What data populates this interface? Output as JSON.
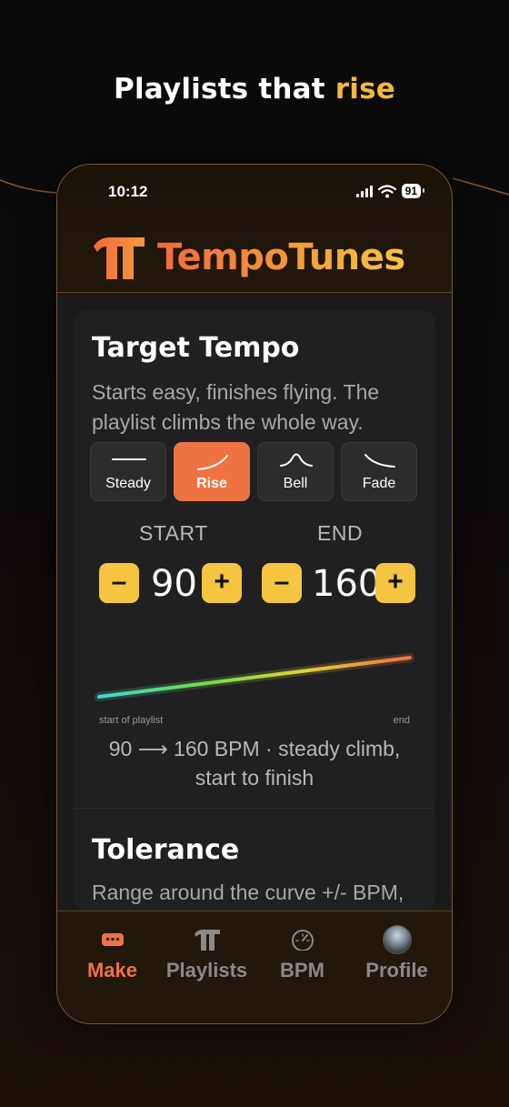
{
  "headline": {
    "prefix": "Playlists that",
    "accent": "rise"
  },
  "status_bar": {
    "time": "10:12",
    "battery": "91"
  },
  "app": {
    "name": "TempoTunes"
  },
  "target_tempo": {
    "title": "Target Tempo",
    "description": "Starts easy, finishes flying. The playlist climbs the whole way.",
    "modes": [
      {
        "label": "Steady",
        "icon": "flat-line-icon",
        "active": false
      },
      {
        "label": "Rise",
        "icon": "rising-curve-icon",
        "active": true
      },
      {
        "label": "Bell",
        "icon": "bell-curve-icon",
        "active": false
      },
      {
        "label": "Fade",
        "icon": "falling-curve-icon",
        "active": false
      }
    ],
    "start": {
      "label": "START",
      "value": "90",
      "minus": "–",
      "plus": "+"
    },
    "end": {
      "label": "END",
      "value": "160",
      "minus": "–",
      "plus": "+"
    },
    "axis_start": "start of playlist",
    "axis_end": "end",
    "summary": "90 ⟶ 160 BPM · steady climb, start to finish"
  },
  "tolerance": {
    "title": "Tolerance",
    "description": "Range around the curve +/- BPM,"
  },
  "tabs": [
    {
      "label": "Make",
      "icon": "make-icon",
      "active": true
    },
    {
      "label": "Playlists",
      "icon": "playlists-logo-icon",
      "active": false
    },
    {
      "label": "BPM",
      "icon": "speedometer-icon",
      "active": false
    },
    {
      "label": "Profile",
      "icon": "avatar",
      "active": false
    }
  ],
  "colors": {
    "accent_orange": "#ee7244",
    "accent_yellow": "#f5c542",
    "headline_accent": "#f5b93a",
    "border_gold": "#7a5a30"
  }
}
